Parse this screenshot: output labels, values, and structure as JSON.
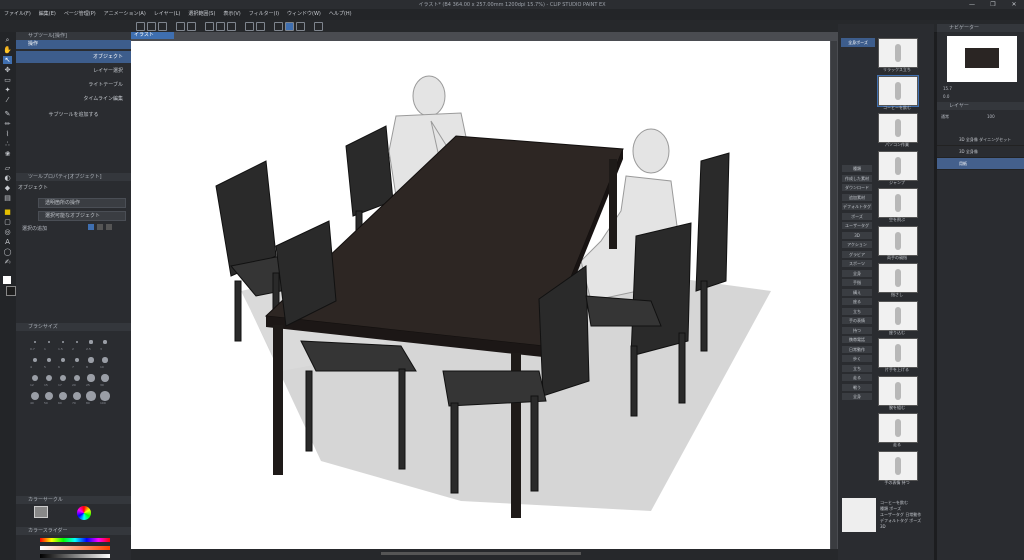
{
  "titlebar": {
    "title": "イラスト* (B4 364.00 x 257.00mm 1200dpi 15.7%) - CLIP STUDIO PAINT EX"
  },
  "window_controls": {
    "minimize": "—",
    "maximize": "❐",
    "close": "✕"
  },
  "menubar": {
    "items": [
      "ファイル(F)",
      "編集(E)",
      "ページ管理(P)",
      "アニメーション(A)",
      "レイヤー(L)",
      "選択範囲(S)",
      "表示(V)",
      "フィルター(I)",
      "ウィンドウ(W)",
      "ヘルプ(H)"
    ]
  },
  "canvas": {
    "tab_label": "イラスト"
  },
  "subtool": {
    "panel_title": "サブツール[操作]",
    "group_label": "操作",
    "items": [
      "オブジェクト",
      "レイヤー選択",
      "ライトテーブル",
      "タイムライン編集"
    ],
    "add_label": "サブツールを追加する",
    "detail_title": "ツールプロパティ[オブジェクト]",
    "detail_subtitle": "オブジェクト",
    "field1": "透明箇所の操作",
    "field2": "選択可能なオブジェクト",
    "field3_label": "選択の追加",
    "brush_title": "ブラシサイズ",
    "brush_sizes": [
      "0.7",
      "1",
      "1.5",
      "2",
      "2.5",
      "3",
      "4",
      "5",
      "6",
      "7",
      "8",
      "10",
      "12",
      "15",
      "17",
      "20",
      "25",
      "30",
      "40",
      "50",
      "60",
      "70",
      "80",
      "100"
    ]
  },
  "colorwheel": {
    "title": "カラーサークル"
  },
  "colorslider": {
    "title": "カラースライダー"
  },
  "materials": {
    "tab_label": "全身ポーズ",
    "tags": [
      "種類",
      "作成した素材",
      "ダウンロード",
      "追加素材",
      "デフォルトタグ",
      "ポーズ",
      "ユーザータグ",
      "3D",
      "アクション",
      "グラビア",
      "スポーツ",
      "全身",
      "手指",
      "構え",
      "座る",
      "立ち",
      "手の表情",
      "持つ",
      "携帯電話",
      "日常動作",
      "歩く",
      "立ち",
      "走る",
      "戦う",
      "全身"
    ],
    "thumbs": [
      "リラックス立ち",
      "コーヒーを飲む",
      "パソコン作業",
      "ジャンプ",
      "空を飛ぶ",
      "両手の親指",
      "指さし",
      "座り込む",
      "片手を上げる",
      "腕を組む",
      "走る",
      "手の表情 持つ"
    ],
    "detail": [
      "コーヒーを飲む",
      "種類 ポーズ",
      "ユーザータグ 日常動作",
      "デフォルトタグ ポーズ",
      "3D"
    ]
  },
  "navigator": {
    "title": "ナビゲーター",
    "zoom": "15.7",
    "angle": "0.0"
  },
  "layers": {
    "title": "レイヤー",
    "blend": "通常",
    "opacity": "100",
    "items": [
      "3D 全身像\nダイニングセット",
      "3D 全身像",
      "用紙"
    ]
  }
}
